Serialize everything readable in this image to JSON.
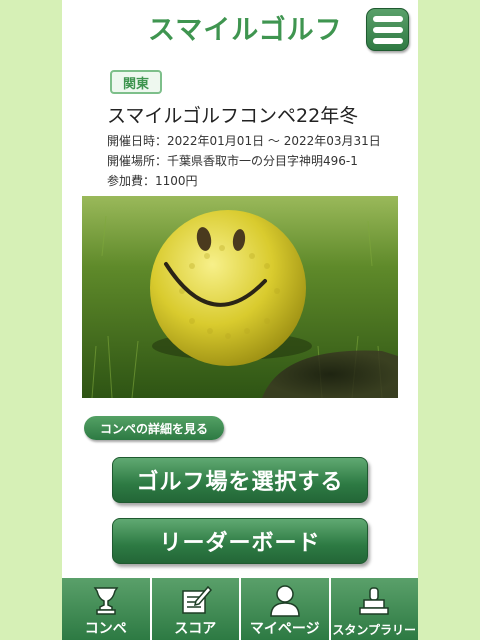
{
  "header": {
    "title": "スマイルゴルフ"
  },
  "event": {
    "region": "関東",
    "title": "スマイルゴルフコンペ22年冬",
    "date": "開催日時：2022年01月01日 〜 2022年03月31日",
    "place": "開催場所：千葉県香取市一の分目字神明496-1",
    "fee": "参加費：1100円"
  },
  "buttons": {
    "detail": "コンペの詳細を見る",
    "select_course": "ゴルフ場を選択する",
    "leaderboard": "リーダーボード"
  },
  "tabs": [
    {
      "label": "コンペ",
      "icon": "trophy-icon"
    },
    {
      "label": "スコア",
      "icon": "scorecard-icon"
    },
    {
      "label": "マイページ",
      "icon": "user-icon"
    },
    {
      "label": "スタンプラリー",
      "icon": "stamp-icon"
    }
  ],
  "colors": {
    "brand": "#3f9550",
    "button": "#2d7a43",
    "background": "#d6f0b6"
  }
}
